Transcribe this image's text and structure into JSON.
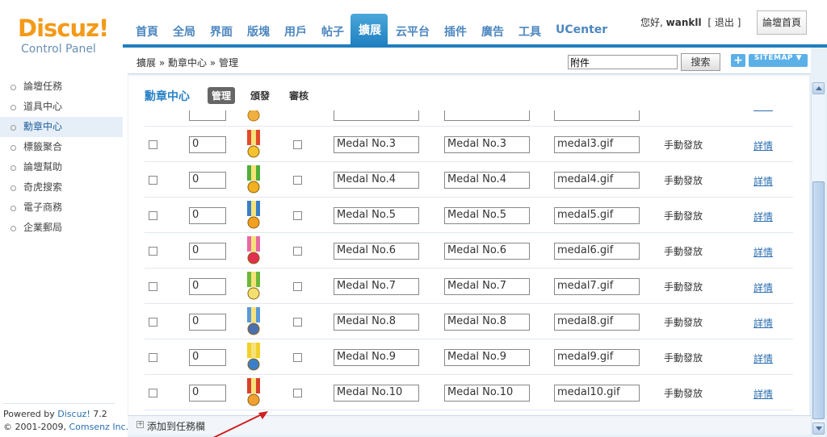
{
  "logo": {
    "brand": "Discuz!",
    "subtitle": "Control Panel"
  },
  "topnav": [
    {
      "label": "首頁",
      "active": false
    },
    {
      "label": "全局",
      "active": false
    },
    {
      "label": "界面",
      "active": false
    },
    {
      "label": "版塊",
      "active": false
    },
    {
      "label": "用戶",
      "active": false
    },
    {
      "label": "帖子",
      "active": false
    },
    {
      "label": "擴展",
      "active": true
    },
    {
      "label": "云平台",
      "active": false
    },
    {
      "label": "插件",
      "active": false
    },
    {
      "label": "廣告",
      "active": false
    },
    {
      "label": "工具",
      "active": false
    },
    {
      "label": "UCenter",
      "active": false
    }
  ],
  "user": {
    "greeting": "您好,",
    "name": "wankll",
    "logout": "[ 退出 ]",
    "home_button": "論壇首頁"
  },
  "sidebar": {
    "items": [
      {
        "label": "論壇任務",
        "active": false
      },
      {
        "label": "道具中心",
        "active": false
      },
      {
        "label": "勳章中心",
        "active": true
      },
      {
        "label": "標籤聚合",
        "active": false
      },
      {
        "label": "論壇幫助",
        "active": false
      },
      {
        "label": "奇虎搜索",
        "active": false
      },
      {
        "label": "電子商務",
        "active": false
      },
      {
        "label": "企業郵局",
        "active": false
      }
    ],
    "footer_line1_prefix": "Powered by ",
    "footer_line1_brand": "Discuz!",
    "footer_line1_version": " 7.2",
    "footer_line2_prefix": "© 2001-2009, ",
    "footer_line2_company": "Comsenz Inc."
  },
  "breadcrumb": "擴展 » 勳章中心 » 管理",
  "search": {
    "value": "附件",
    "button": "搜索"
  },
  "sitemap_button": "SITEMAP",
  "page": {
    "title": "勳章中心",
    "tabs": [
      {
        "label": "管理",
        "active": true
      },
      {
        "label": "頒發",
        "active": false
      },
      {
        "label": "審核",
        "active": false
      }
    ]
  },
  "medals": [
    {
      "order": "0",
      "name": "Medal No.3",
      "desc": "Medal No.3",
      "image": "medal3.gif",
      "type": "手動發放",
      "detail": "詳情",
      "colors": [
        "#e24a2a",
        "#f5c230"
      ]
    },
    {
      "order": "0",
      "name": "Medal No.4",
      "desc": "Medal No.4",
      "image": "medal4.gif",
      "type": "手動發放",
      "detail": "詳情",
      "colors": [
        "#4fae3a",
        "#f0b020"
      ]
    },
    {
      "order": "0",
      "name": "Medal No.5",
      "desc": "Medal No.5",
      "image": "medal5.gif",
      "type": "手動發放",
      "detail": "詳情",
      "colors": [
        "#3a7ec8",
        "#f0a020"
      ]
    },
    {
      "order": "0",
      "name": "Medal No.6",
      "desc": "Medal No.6",
      "image": "medal6.gif",
      "type": "手動發放",
      "detail": "詳情",
      "colors": [
        "#e76aa3",
        "#e03050"
      ]
    },
    {
      "order": "0",
      "name": "Medal No.7",
      "desc": "Medal No.7",
      "image": "medal7.gif",
      "type": "手動發放",
      "detail": "詳情",
      "colors": [
        "#6cb83a",
        "#f4e070"
      ]
    },
    {
      "order": "0",
      "name": "Medal No.8",
      "desc": "Medal No.8",
      "image": "medal8.gif",
      "type": "手動發放",
      "detail": "詳情",
      "colors": [
        "#5a9ad8",
        "#4a70b0"
      ]
    },
    {
      "order": "0",
      "name": "Medal No.9",
      "desc": "Medal No.9",
      "image": "medal9.gif",
      "type": "手動發放",
      "detail": "詳情",
      "colors": [
        "#f2cf2a",
        "#3a80c8"
      ]
    },
    {
      "order": "0",
      "name": "Medal No.10",
      "desc": "Medal No.10",
      "image": "medal10.gif",
      "type": "手動發放",
      "detail": "詳情",
      "colors": [
        "#d8402a",
        "#f0a030"
      ]
    }
  ],
  "add_to_taskbar": "添加到任務欄"
}
